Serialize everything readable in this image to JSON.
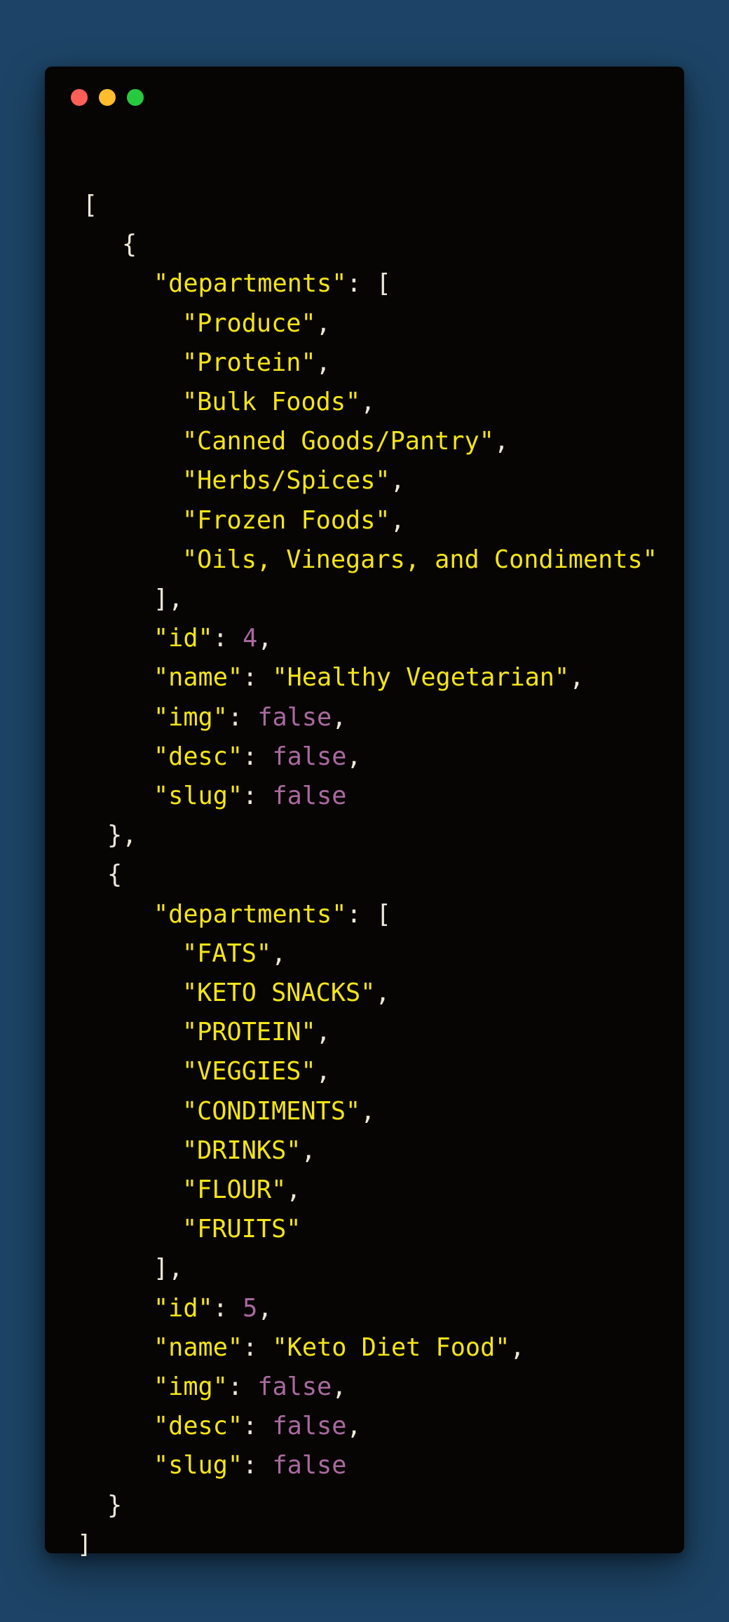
{
  "window": {
    "buttons": [
      {
        "name": "close",
        "color": "#ff5f56"
      },
      {
        "name": "minimize",
        "color": "#ffbd2e"
      },
      {
        "name": "zoom",
        "color": "#27c93f"
      }
    ]
  },
  "theme": {
    "background": "#1d4466",
    "editor_background": "#070404",
    "string_color": "#f4e515",
    "literal_color": "#a9699f",
    "punctuation_color": "#ece8d6"
  },
  "code": {
    "lines": [
      {
        "text": "["
      },
      {
        "text": "{"
      },
      {
        "key": "\"departments\"",
        "rest": ": ["
      },
      {
        "str": "\"Produce\"",
        "rest": ","
      },
      {
        "str": "\"Protein\"",
        "rest": ","
      },
      {
        "str": "\"Bulk Foods\"",
        "rest": ","
      },
      {
        "str": "\"Canned Goods/Pantry\"",
        "rest": ","
      },
      {
        "str": "\"Herbs/Spices\"",
        "rest": ","
      },
      {
        "str": "\"Frozen Foods\"",
        "rest": ","
      },
      {
        "str": "\"Oils, Vinegars, and Condiments\""
      },
      {
        "text": "],"
      },
      {
        "key": "\"id\"",
        "colon": ": ",
        "num": "4",
        "rest": ","
      },
      {
        "key": "\"name\"",
        "colon": ": ",
        "str": "\"Healthy Vegetarian\"",
        "rest": ","
      },
      {
        "key": "\"img\"",
        "colon": ": ",
        "num": "false",
        "rest": ","
      },
      {
        "key": "\"desc\"",
        "colon": ": ",
        "num": "false",
        "rest": ","
      },
      {
        "key": "\"slug\"",
        "colon": ": ",
        "num": "false"
      },
      {
        "text": "},"
      },
      {
        "text": "{"
      },
      {
        "key": "\"departments\"",
        "rest": ": ["
      },
      {
        "str": "\"FATS\"",
        "rest": ","
      },
      {
        "str": "\"KETO SNACKS\"",
        "rest": ","
      },
      {
        "str": "\"PROTEIN\"",
        "rest": ","
      },
      {
        "str": "\"VEGGIES\"",
        "rest": ","
      },
      {
        "str": "\"CONDIMENTS\"",
        "rest": ","
      },
      {
        "str": "\"DRINKS\"",
        "rest": ","
      },
      {
        "str": "\"FLOUR\"",
        "rest": ","
      },
      {
        "str": "\"FRUITS\""
      },
      {
        "text": "],"
      },
      {
        "key": "\"id\"",
        "colon": ": ",
        "num": "5",
        "rest": ","
      },
      {
        "key": "\"name\"",
        "colon": ": ",
        "str": "\"Keto Diet Food\"",
        "rest": ","
      },
      {
        "key": "\"img\"",
        "colon": ": ",
        "num": "false",
        "rest": ","
      },
      {
        "key": "\"desc\"",
        "colon": ": ",
        "num": "false",
        "rest": ","
      },
      {
        "key": "\"slug\"",
        "colon": ": ",
        "num": "false"
      },
      {
        "text": "}"
      },
      {
        "text": "]"
      }
    ]
  }
}
